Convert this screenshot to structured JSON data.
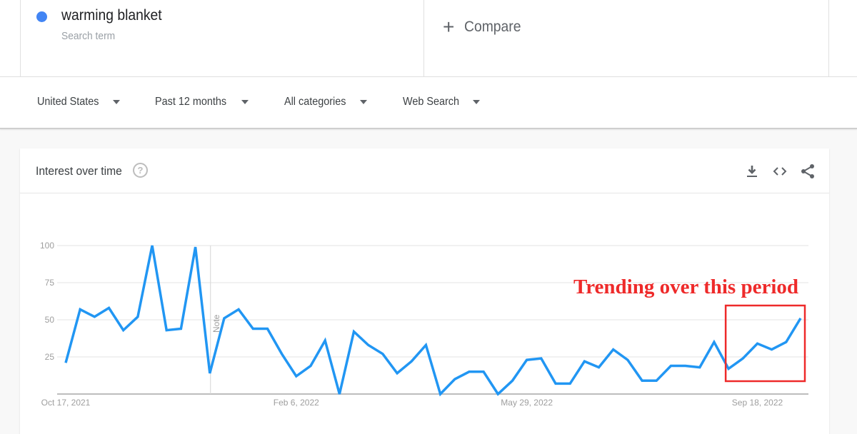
{
  "search_term": {
    "label": "warming blanket",
    "sublabel": "Search term",
    "color": "#4285f4"
  },
  "compare": {
    "icon": "plus-icon",
    "label": "Compare"
  },
  "filters": [
    {
      "label": "United States"
    },
    {
      "label": "Past 12 months"
    },
    {
      "label": "All categories"
    },
    {
      "label": "Web Search"
    }
  ],
  "card": {
    "title": "Interest over time",
    "help_icon": "help-icon",
    "tools": [
      "download-icon",
      "embed-code-icon",
      "share-icon"
    ]
  },
  "annotation": {
    "text": "Trending over this period",
    "color": "#ee2a2a"
  },
  "chart_data": {
    "type": "line",
    "title": "Interest over time",
    "series": [
      {
        "name": "warming blanket",
        "color": "#2196f3",
        "values": [
          21,
          57,
          52,
          58,
          43,
          52,
          100,
          43,
          44,
          99,
          14,
          51,
          57,
          44,
          44,
          27,
          12,
          19,
          36,
          0,
          42,
          33,
          27,
          14,
          22,
          33,
          0,
          10,
          15,
          15,
          0,
          9,
          23,
          24,
          7,
          7,
          22,
          18,
          30,
          23,
          9,
          9,
          19,
          19,
          18,
          35,
          17,
          24,
          34,
          30,
          35,
          51
        ]
      }
    ],
    "x_tick_labels": [
      "Oct 17, 2021",
      "Feb 6, 2022",
      "May 29, 2022",
      "Sep 18, 2022"
    ],
    "x_tick_indices": [
      0,
      16,
      32,
      48
    ],
    "y_ticks": [
      25,
      50,
      75,
      100
    ],
    "ylim": [
      0,
      100
    ],
    "grid": true,
    "note_marker": {
      "label": "Note",
      "index": 10
    },
    "highlight_range": {
      "start_index": 46,
      "end_index": 51
    },
    "xlabel": "",
    "ylabel": ""
  }
}
